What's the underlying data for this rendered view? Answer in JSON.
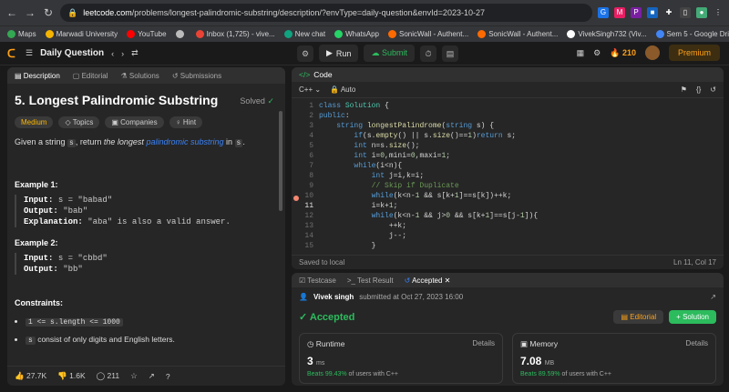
{
  "browser": {
    "url_host": "leetcode.com",
    "url_path": "/problems/longest-palindromic-substring/description/?envType=daily-question&envId=2023-10-27"
  },
  "bookmarks": [
    {
      "label": "Maps",
      "color": "#34a853"
    },
    {
      "label": "Marwadi University",
      "color": "#f4b400"
    },
    {
      "label": "YouTube",
      "color": "#ff0000"
    },
    {
      "label": "",
      "color": "#bbbbbb"
    },
    {
      "label": "Inbox (1,725) - vive...",
      "color": "#ea4335"
    },
    {
      "label": "New chat",
      "color": "#10a37f"
    },
    {
      "label": "WhatsApp",
      "color": "#25d366"
    },
    {
      "label": "SonicWall - Authent...",
      "color": "#ff6a00"
    },
    {
      "label": "SonicWall - Authent...",
      "color": "#ff6a00"
    },
    {
      "label": "VivekSingh732 (Viv...",
      "color": "#ffffff"
    },
    {
      "label": "Sem 5 - Google Drive",
      "color": "#4285f4"
    }
  ],
  "topbar": {
    "daily_question": "Daily Question",
    "run": "Run",
    "submit": "Submit",
    "streak": "210",
    "premium": "Premium"
  },
  "left_tabs": [
    "Description",
    "Editorial",
    "Solutions",
    "Submissions"
  ],
  "problem": {
    "title": "5. Longest Palindromic Substring",
    "solved": "Solved",
    "difficulty": "Medium",
    "chips": [
      "Topics",
      "Companies",
      "Hint"
    ],
    "desc_pre": "Given a string",
    "desc_s": "s",
    "desc_mid": ", return",
    "desc_em": "the longest",
    "desc_link": "palindromic substring",
    "desc_in": "in",
    "desc_s2": "s",
    "example1_title": "Example 1:",
    "example1_input": "s = \"babad\"",
    "example1_output": "\"bab\"",
    "example1_expl": "\"aba\" is also a valid answer.",
    "example2_title": "Example 2:",
    "example2_input": "s = \"cbbd\"",
    "example2_output": "\"bb\"",
    "constraints_title": "Constraints:",
    "c1": "1 <= s.length <= 1000",
    "c2_mono": "s",
    "c2_text": "consist of only digits and English letters.",
    "label_input": "Input:",
    "label_output": "Output:",
    "label_expl": "Explanation:"
  },
  "left_footer": {
    "likes": "27.7K",
    "dislikes": "1.6K",
    "comments": "211"
  },
  "code": {
    "header": "Code",
    "language": "C++",
    "mode": "Auto",
    "saved": "Saved to local",
    "position": "Ln 11, Col 17",
    "line_numbers": [
      "1",
      "2",
      "3",
      "4",
      "5",
      "6",
      "7",
      "8",
      "9",
      "10",
      "11",
      "12",
      "13",
      "14",
      "15",
      "16"
    ]
  },
  "result": {
    "tabs": [
      "Testcase",
      "Test Result",
      "Accepted"
    ],
    "user": "Vivek singh",
    "submitted": "submitted at Oct 27, 2023 16:00",
    "status": "Accepted",
    "editorial": "Editorial",
    "solution": "Solution",
    "runtime_title": "Runtime",
    "runtime_val": "3",
    "runtime_unit": "ms",
    "runtime_beats": "Beats 99.43%",
    "memory_title": "Memory",
    "memory_val": "7.08",
    "memory_unit": "MB",
    "memory_beats": "Beats 89.59%",
    "beats_suffix": "of users with C++",
    "details": "Details"
  }
}
